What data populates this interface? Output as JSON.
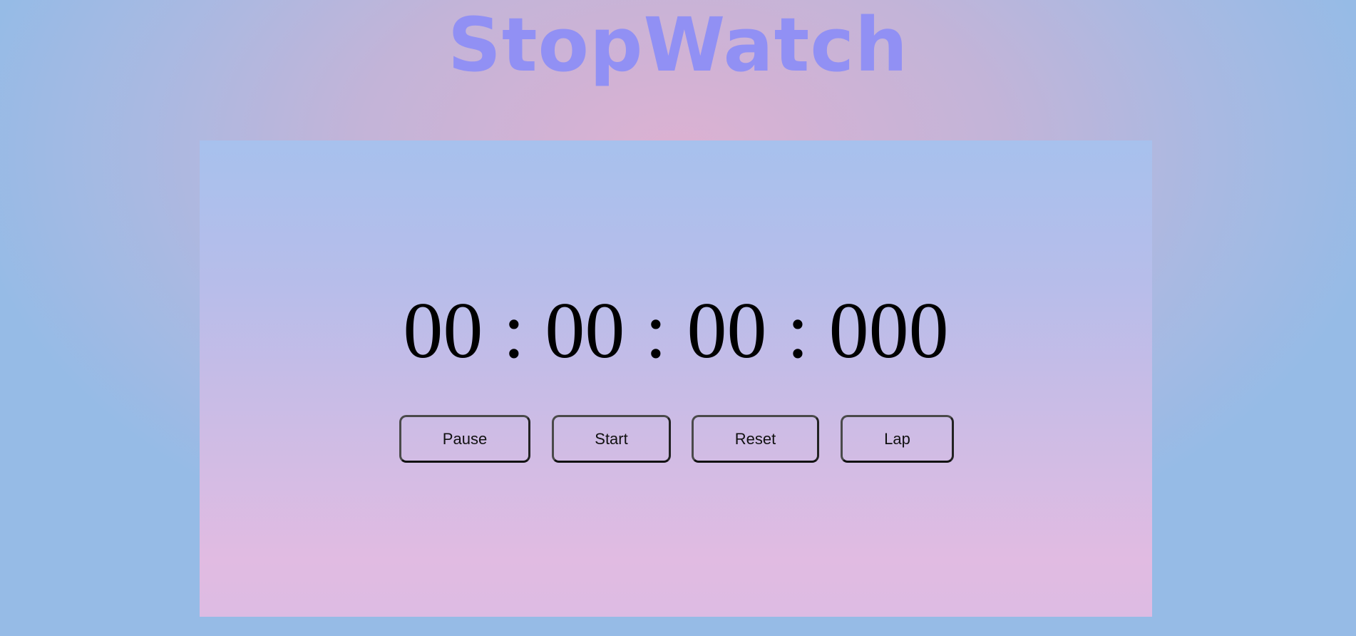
{
  "header": {
    "title": "StopWatch"
  },
  "stopwatch": {
    "display": "00 : 00 : 00 : 000",
    "hours": "00",
    "minutes": "00",
    "seconds": "00",
    "milliseconds": "000"
  },
  "controls": {
    "pause_label": "Pause",
    "start_label": "Start",
    "reset_label": "Reset",
    "lap_label": "Lap"
  },
  "colors": {
    "title": "#9190f4",
    "text": "#000000",
    "button_border": "#4a4a4a",
    "panel_top": "#a7c1ed",
    "panel_bottom": "#e1bbe2",
    "page_center": "#dcb1d2",
    "page_edge": "#96bbe6"
  }
}
